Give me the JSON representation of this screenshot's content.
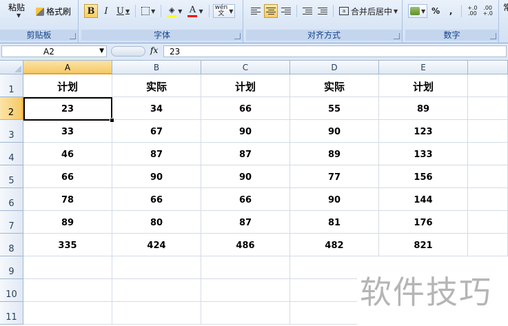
{
  "ribbon": {
    "clipboard": {
      "paste_label": "粘贴",
      "format_painter_label": "格式刷",
      "group_label": "剪贴板"
    },
    "font": {
      "bold": "B",
      "italic": "I",
      "underline": "U",
      "wen": "wén\n文",
      "group_label": "字体"
    },
    "alignment": {
      "merge_label": "合并后居中",
      "group_label": "对齐方式"
    },
    "number": {
      "percent": "%",
      "comma": ",",
      "inc_decimal": "+.0\n.00",
      "dec_decimal": ".00\n+.0",
      "group_label": "数字"
    },
    "extra_label": "常"
  },
  "formula_bar": {
    "name_box": "A2",
    "fx": "fx",
    "content": "23"
  },
  "columns": [
    "A",
    "B",
    "C",
    "D",
    "E"
  ],
  "rows": [
    "1",
    "2",
    "3",
    "4",
    "5",
    "6",
    "7",
    "8",
    "9",
    "10",
    "11"
  ],
  "cells": [
    [
      "计划",
      "实际",
      "计划",
      "实际",
      "计划"
    ],
    [
      "23",
      "34",
      "66",
      "55",
      "89"
    ],
    [
      "33",
      "67",
      "90",
      "90",
      "123"
    ],
    [
      "46",
      "87",
      "87",
      "89",
      "133"
    ],
    [
      "66",
      "90",
      "90",
      "77",
      "156"
    ],
    [
      "78",
      "66",
      "66",
      "90",
      "144"
    ],
    [
      "89",
      "80",
      "87",
      "81",
      "176"
    ],
    [
      "335",
      "424",
      "486",
      "482",
      "821"
    ]
  ],
  "selection": {
    "cell": "A2",
    "highlight_color": "#f6c966"
  },
  "watermark": "软件技巧"
}
